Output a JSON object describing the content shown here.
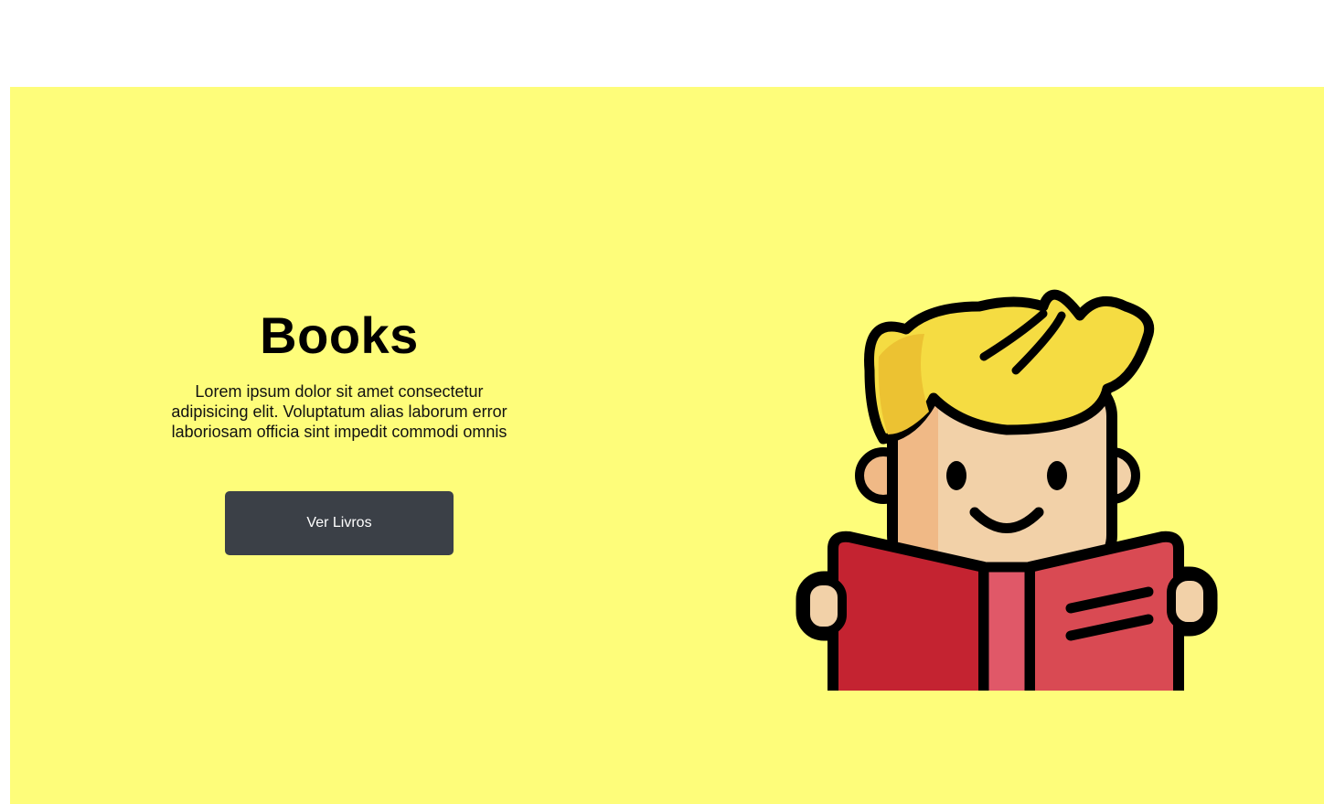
{
  "hero": {
    "title": "Books",
    "description": "Lorem ipsum dolor sit amet consectetur adipisicing elit. Voluptatum alias laborum error laboriosam officia sint impedit commodi omnis",
    "button_label": "Ver Livros",
    "background_color": "#fefd7a",
    "illustration_icon": "boy-reading-book-icon"
  },
  "colors": {
    "button_bg": "#3b4047",
    "hair": "#f5dc42",
    "skin": "#f2d1a8",
    "book": "#c42331"
  }
}
